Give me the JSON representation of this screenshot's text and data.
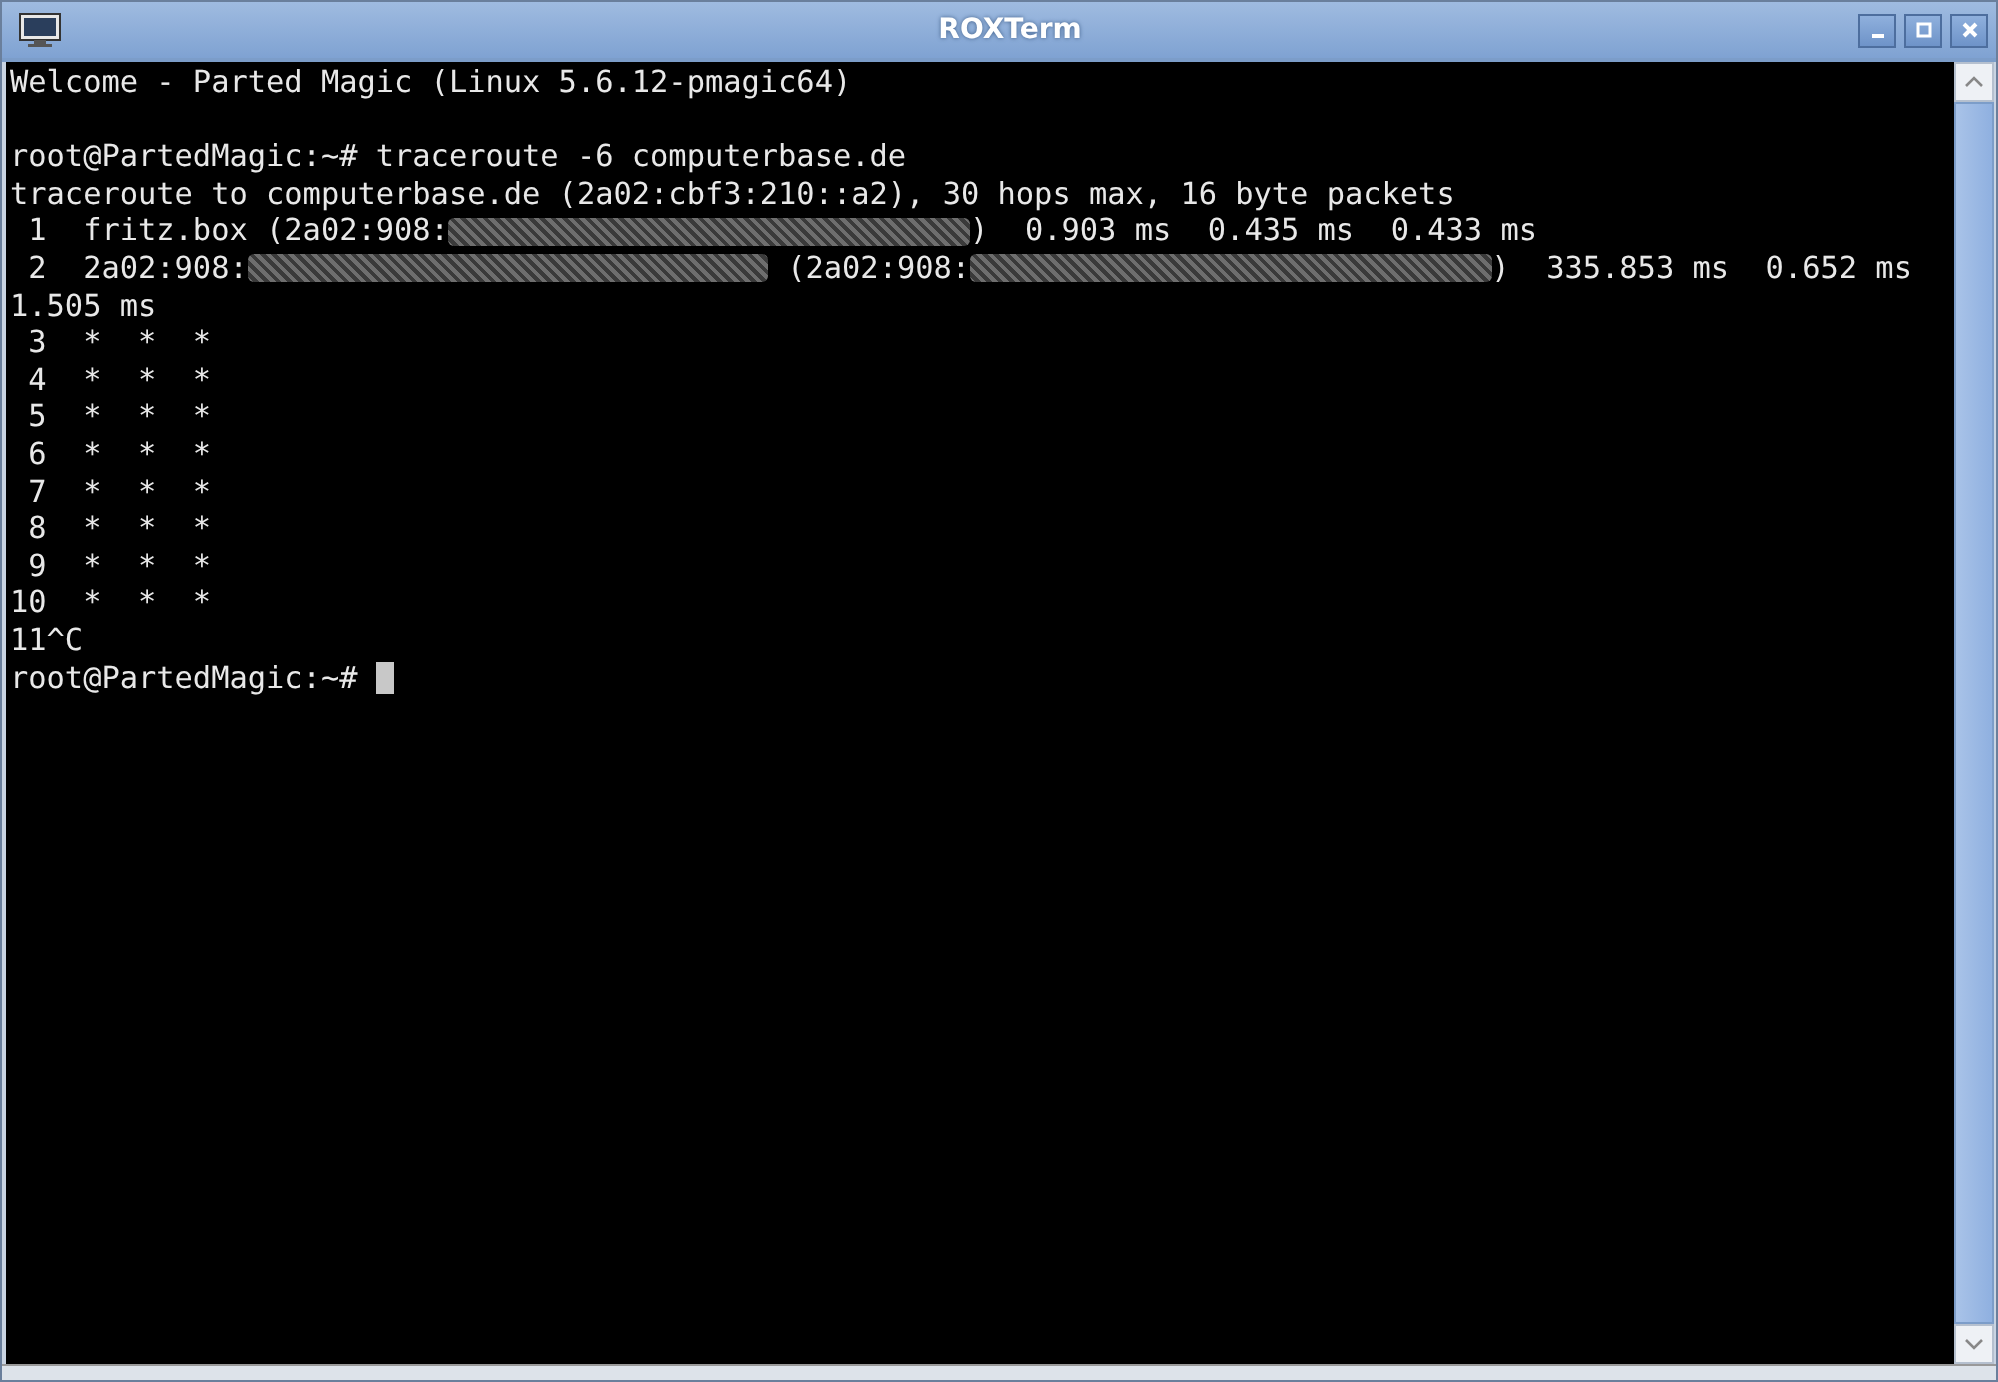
{
  "window": {
    "title": "ROXTerm"
  },
  "terminal": {
    "lines": [
      {
        "kind": "text",
        "segments": [
          {
            "kind": "text",
            "text": "Welcome - Parted Magic (Linux 5.6.12-pmagic64)"
          }
        ]
      },
      {
        "kind": "blank"
      },
      {
        "kind": "text",
        "segments": [
          {
            "kind": "text",
            "text": "root@PartedMagic:~# traceroute -6 computerbase.de"
          }
        ]
      },
      {
        "kind": "text",
        "segments": [
          {
            "kind": "text",
            "text": "traceroute to computerbase.de (2a02:cbf3:210::a2), 30 hops max, 16 byte packets"
          }
        ]
      },
      {
        "kind": "text",
        "segments": [
          {
            "kind": "text",
            "text": " 1  fritz.box (2a02:908:"
          },
          {
            "kind": "redacted"
          },
          {
            "kind": "text",
            "text": ")  0.903 ms  0.435 ms  0.433 ms"
          }
        ]
      },
      {
        "kind": "text",
        "segments": [
          {
            "kind": "text",
            "text": " 2  2a02:908:"
          },
          {
            "kind": "redacted"
          },
          {
            "kind": "text",
            "text": " (2a02:908:"
          },
          {
            "kind": "redacted"
          },
          {
            "kind": "text",
            "text": ")  335.853 ms  0.652 ms"
          }
        ]
      },
      {
        "kind": "text",
        "segments": [
          {
            "kind": "text",
            "text": "1.505 ms"
          }
        ]
      },
      {
        "kind": "text",
        "segments": [
          {
            "kind": "text",
            "text": " 3  *  *  *"
          }
        ]
      },
      {
        "kind": "text",
        "segments": [
          {
            "kind": "text",
            "text": " 4  *  *  *"
          }
        ]
      },
      {
        "kind": "text",
        "segments": [
          {
            "kind": "text",
            "text": " 5  *  *  *"
          }
        ]
      },
      {
        "kind": "text",
        "segments": [
          {
            "kind": "text",
            "text": " 6  *  *  *"
          }
        ]
      },
      {
        "kind": "text",
        "segments": [
          {
            "kind": "text",
            "text": " 7  *  *  *"
          }
        ]
      },
      {
        "kind": "text",
        "segments": [
          {
            "kind": "text",
            "text": " 8  *  *  *"
          }
        ]
      },
      {
        "kind": "text",
        "segments": [
          {
            "kind": "text",
            "text": " 9  *  *  *"
          }
        ]
      },
      {
        "kind": "text",
        "segments": [
          {
            "kind": "text",
            "text": "10  *  *  *"
          }
        ]
      },
      {
        "kind": "text",
        "segments": [
          {
            "kind": "text",
            "text": "11^C"
          }
        ]
      },
      {
        "kind": "text",
        "segments": [
          {
            "kind": "text",
            "text": "root@PartedMagic:~# "
          },
          {
            "kind": "cursor"
          }
        ]
      }
    ]
  }
}
